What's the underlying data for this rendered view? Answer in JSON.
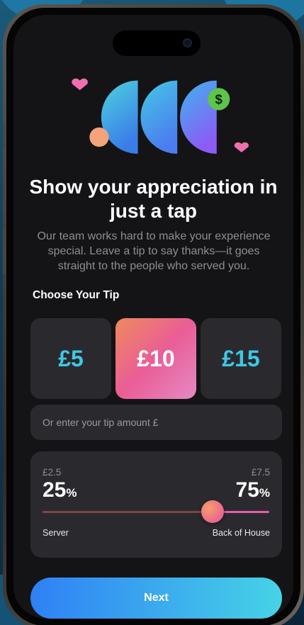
{
  "hero": {
    "title": "Show your appreciation in just a tap",
    "subtitle": "Our team works hard to make your experience special. Leave a tip to say thanks—it goes straight to the people who served you.",
    "badge_symbol": "$"
  },
  "tip": {
    "heading": "Choose Your Tip",
    "options": [
      {
        "label": "£5",
        "selected": false
      },
      {
        "label": "£10",
        "selected": true
      },
      {
        "label": "£15",
        "selected": false
      }
    ],
    "custom_placeholder": "Or enter your tip amount £"
  },
  "split": {
    "left": {
      "amount": "£2.5",
      "percent": "25",
      "label": "Server"
    },
    "right": {
      "amount": "£7.5",
      "percent": "75",
      "label": "Back of House"
    },
    "percent_unit": "%",
    "slider_value": 0.75
  },
  "actions": {
    "next_label": "Next"
  },
  "colors": {
    "accent_cyan": "#3ec8e6",
    "accent_blue": "#2f80f5",
    "accent_pink": "#ea5d96",
    "accent_orange": "#ee8a5c",
    "badge_green": "#5cc54a",
    "screen_bg": "#141416",
    "card_bg": "#2a2a2e"
  }
}
